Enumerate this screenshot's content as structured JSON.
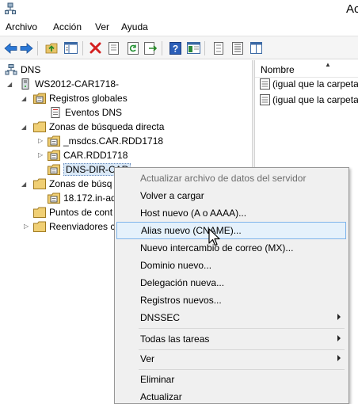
{
  "window": {
    "title": "Ac"
  },
  "menubar": {
    "items": [
      "Archivo",
      "Acción",
      "Ver",
      "Ayuda"
    ]
  },
  "toolbar": {
    "icons": [
      "back-arrow-icon",
      "forward-arrow-icon",
      "up-folder-icon",
      "show-hide-tree-icon",
      "delete-icon",
      "properties-icon",
      "refresh-icon",
      "export-list-icon",
      "help-icon",
      "help-pane-icon",
      "list-view-icon",
      "detail-view-icon",
      "columns-icon"
    ]
  },
  "tree": {
    "nodes": [
      {
        "label": "DNS",
        "icon": "dns-icon",
        "expander": ""
      },
      {
        "label": "WS2012-CAR1718-",
        "icon": "server-icon",
        "expander": "expanded"
      },
      {
        "label": "Registros globales",
        "icon": "global-folder-icon",
        "expander": "expanded"
      },
      {
        "label": "Eventos DNS",
        "icon": "event-log-icon",
        "expander": ""
      },
      {
        "label": "Zonas de búsqueda directa",
        "icon": "folder-icon",
        "expander": "expanded"
      },
      {
        "label": "_msdcs.CAR.RDD1718",
        "icon": "zone-icon",
        "expander": "collapsed"
      },
      {
        "label": "CAR.RDD1718",
        "icon": "zone-icon",
        "expander": "collapsed"
      },
      {
        "label": "DNS-DIR-CAR",
        "icon": "zone-icon",
        "expander": ""
      },
      {
        "label": "Zonas de búsq",
        "icon": "folder-icon",
        "expander": "expanded"
      },
      {
        "label": "18.172.in-ad",
        "icon": "zone-icon",
        "expander": ""
      },
      {
        "label": "Puntos de cont",
        "icon": "folder-icon",
        "expander": ""
      },
      {
        "label": "Reenviadores c",
        "icon": "folder-icon",
        "expander": "collapsed"
      }
    ]
  },
  "list": {
    "column": "Nombre",
    "rows": [
      "(igual que la carpeta",
      "(igual que la carpeta"
    ]
  },
  "context_menu": {
    "items": [
      {
        "label": "Actualizar archivo de datos del servidor",
        "disabled": true
      },
      {
        "label": "Volver a cargar"
      },
      {
        "label": "Host nuevo (A o AAAA)..."
      },
      {
        "label": "Alias nuevo (CNAME)...",
        "hover": true
      },
      {
        "label": "Nuevo intercambio de correo (MX)..."
      },
      {
        "label": "Dominio nuevo..."
      },
      {
        "label": "Delegación nueva..."
      },
      {
        "label": "Registros nuevos..."
      },
      {
        "label": "DNSSEC",
        "submenu": true
      },
      {
        "label": "Todas las tareas",
        "submenu": true
      },
      {
        "label": "Ver",
        "submenu": true
      },
      {
        "label": "Eliminar"
      },
      {
        "label": "Actualizar"
      }
    ]
  },
  "colors": {
    "hover_bg": "#e5f1fb",
    "hover_border": "#7eb4ea",
    "selected_bg": "#d9e8f7",
    "menu_bg": "#f0f0f0"
  }
}
